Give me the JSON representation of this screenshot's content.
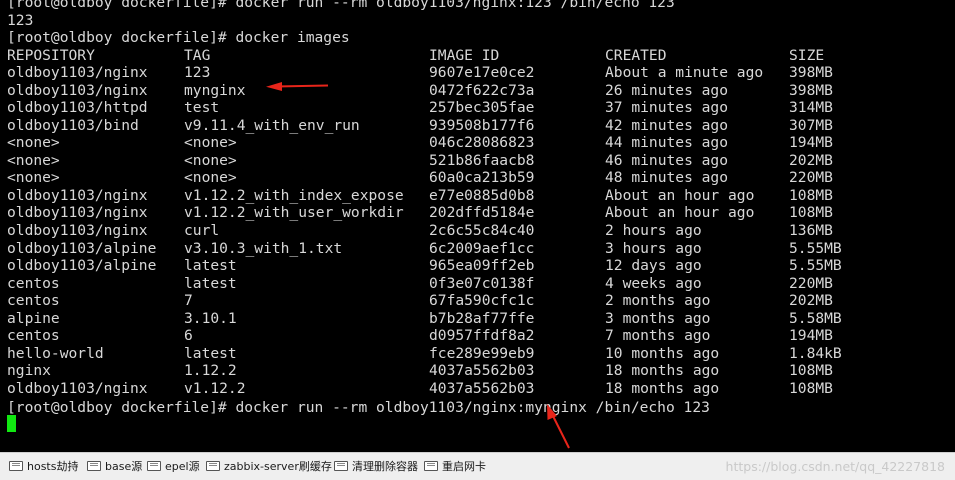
{
  "terminal": {
    "prompt_line_1": "[root@oldboy dockerfile]# docker run --rm oldboy1103/nginx:123 /bin/echo 123",
    "output_1": "123",
    "prompt_line_2": "[root@oldboy dockerfile]# docker images",
    "headers": [
      "REPOSITORY",
      "TAG",
      "IMAGE ID",
      "CREATED",
      "SIZE"
    ],
    "rows": [
      [
        "oldboy1103/nginx",
        "123",
        "9607e17e0ce2",
        "About a minute ago",
        "398MB"
      ],
      [
        "oldboy1103/nginx",
        "mynginx",
        "0472f622c73a",
        "26 minutes ago",
        "398MB"
      ],
      [
        "oldboy1103/httpd",
        "test",
        "257bec305fae",
        "37 minutes ago",
        "314MB"
      ],
      [
        "oldboy1103/bind",
        "v9.11.4_with_env_run",
        "939508b177f6",
        "42 minutes ago",
        "307MB"
      ],
      [
        "<none>",
        "<none>",
        "046c28086823",
        "44 minutes ago",
        "194MB"
      ],
      [
        "<none>",
        "<none>",
        "521b86faacb8",
        "46 minutes ago",
        "202MB"
      ],
      [
        "<none>",
        "<none>",
        "60a0ca213b59",
        "48 minutes ago",
        "220MB"
      ],
      [
        "oldboy1103/nginx",
        "v1.12.2_with_index_expose",
        "e77e0885d0b8",
        "About an hour ago",
        "108MB"
      ],
      [
        "oldboy1103/nginx",
        "v1.12.2_with_user_workdir",
        "202dffd5184e",
        "About an hour ago",
        "108MB"
      ],
      [
        "oldboy1103/nginx",
        "curl",
        "2c6c55c84c40",
        "2 hours ago",
        "136MB"
      ],
      [
        "oldboy1103/alpine",
        "v3.10.3_with_1.txt",
        "6c2009aef1cc",
        "3 hours ago",
        "5.55MB"
      ],
      [
        "oldboy1103/alpine",
        "latest",
        "965ea09ff2eb",
        "12 days ago",
        "5.55MB"
      ],
      [
        "centos",
        "latest",
        "0f3e07c0138f",
        "4 weeks ago",
        "220MB"
      ],
      [
        "centos",
        "7",
        "67fa590cfc1c",
        "2 months ago",
        "202MB"
      ],
      [
        "alpine",
        "3.10.1",
        "b7b28af77ffe",
        "3 months ago",
        "5.58MB"
      ],
      [
        "centos",
        "6",
        "d0957ffdf8a2",
        "7 months ago",
        "194MB"
      ],
      [
        "hello-world",
        "latest",
        "fce289e99eb9",
        "10 months ago",
        "1.84kB"
      ],
      [
        "nginx",
        "1.12.2",
        "4037a5562b03",
        "18 months ago",
        "108MB"
      ],
      [
        "oldboy1103/nginx",
        "v1.12.2",
        "4037a5562b03",
        "18 months ago",
        "108MB"
      ]
    ],
    "prompt_line_3": "[root@oldboy dockerfile]# docker run --rm oldboy1103/nginx:mynginx /bin/echo 123",
    "cursor_color": "#11e811",
    "annotation_color": "#e8251a"
  },
  "quickbar": {
    "buttons": [
      {
        "label": "hosts劫持",
        "icon": "command-button-icon"
      },
      {
        "label": "base源",
        "icon": "command-button-icon"
      },
      {
        "label": "epel源",
        "icon": "command-button-icon"
      },
      {
        "label": "zabbix-server刷缓存",
        "icon": "command-button-icon"
      },
      {
        "label": "清理删除容器",
        "icon": "command-button-icon"
      },
      {
        "label": "重启网卡",
        "icon": "command-button-icon"
      }
    ],
    "watermark": "https://blog.csdn.net/qq_42227818"
  }
}
